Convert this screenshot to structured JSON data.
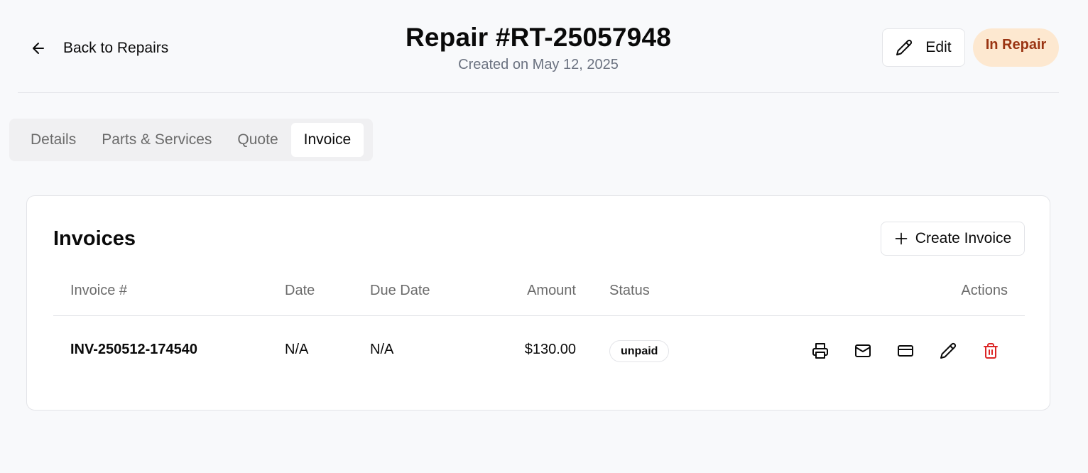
{
  "header": {
    "back_label": "Back to Repairs",
    "title": "Repair #RT-25057948",
    "subtitle": "Created on May 12, 2025",
    "edit_label": "Edit",
    "status": "In Repair"
  },
  "tabs": [
    {
      "label": "Details"
    },
    {
      "label": "Parts & Services"
    },
    {
      "label": "Quote"
    },
    {
      "label": "Invoice",
      "active": true
    }
  ],
  "invoices": {
    "title": "Invoices",
    "create_label": "Create Invoice",
    "columns": {
      "number": "Invoice #",
      "date": "Date",
      "due": "Due Date",
      "amount": "Amount",
      "status": "Status",
      "actions": "Actions"
    },
    "rows": [
      {
        "number": "INV-250512-174540",
        "date": "N/A",
        "due": "N/A",
        "amount": "$130.00",
        "status": "unpaid"
      }
    ],
    "row_actions": [
      "printer-icon",
      "mail-icon",
      "credit-card-icon",
      "pencil-icon",
      "trash-icon"
    ]
  },
  "colors": {
    "status_bg": "#fde8d0",
    "status_text": "#9a3412",
    "delete": "#dc2626"
  }
}
